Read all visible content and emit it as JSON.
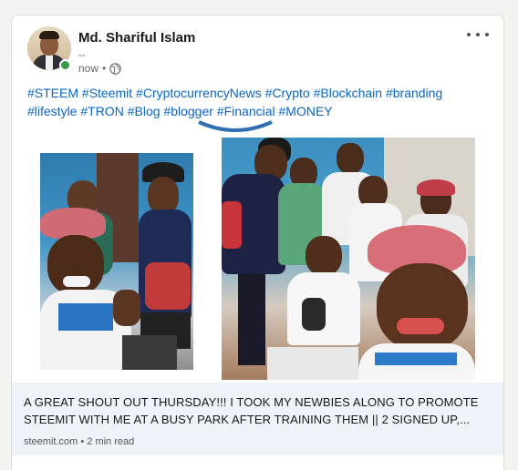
{
  "post": {
    "author_name": "Md. Shariful Islam",
    "author_subtitle": "--",
    "time": "now",
    "separator": "•",
    "visibility_icon": "globe-icon",
    "more_icon": "more-horizontal-icon"
  },
  "hashtags": [
    "#STEEM",
    "#Steemit",
    "#CryptocurrencyNews",
    "#Crypto",
    "#Blockchain",
    "#branding",
    "#lifestyle",
    "#TRON",
    "#Blog",
    "#blogger",
    "#Financial",
    "#MONEY"
  ],
  "link_preview": {
    "title": "A GREAT SHOUT OUT THURSDAY!!! I TOOK MY NEWBIES ALONG TO PROMOTE STEEMIT WITH ME AT A BUSY PARK AFTER TRAINING THEM || 2 SIGNED UP,...",
    "domain": "steemit.com",
    "separator": "•",
    "read_time": "2 min read"
  },
  "colors": {
    "hashtag": "#0a66c2",
    "presence": "#3a9a4a",
    "preview_bg": "#edf3f8"
  }
}
